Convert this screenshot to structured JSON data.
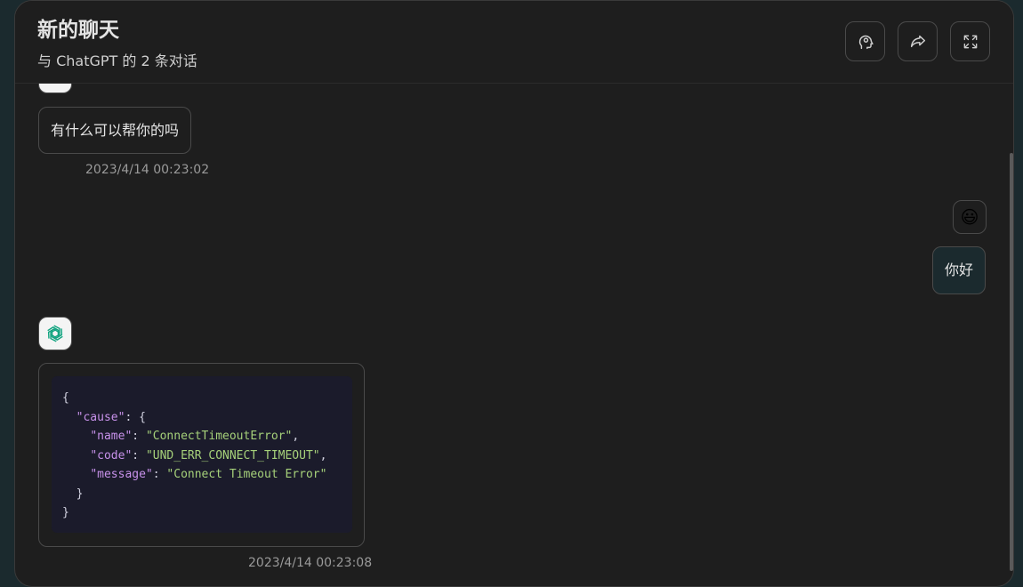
{
  "header": {
    "title": "新的聊天",
    "subtitle": "与 ChatGPT 的 2 条对话",
    "buttons": [
      {
        "name": "prompt-icon",
        "label": "prompt"
      },
      {
        "name": "share-icon",
        "label": "share"
      },
      {
        "name": "fullscreen-icon",
        "label": "fullscreen"
      }
    ]
  },
  "messages": [
    {
      "role": "assistant",
      "text": "有什么可以帮你的吗",
      "time": "2023/4/14 00:23:02"
    },
    {
      "role": "user",
      "avatar": "😃",
      "text": "你好"
    },
    {
      "role": "assistant",
      "code": {
        "l1": "{",
        "l2_key": "\"cause\"",
        "l2_rest": ": {",
        "l3_key": "\"name\"",
        "l3_val": "\"ConnectTimeoutError\"",
        "l4_key": "\"code\"",
        "l4_val": "\"UND_ERR_CONNECT_TIMEOUT\"",
        "l5_key": "\"message\"",
        "l5_val": "\"Connect Timeout Error\"",
        "l6": "}",
        "l7": "}"
      },
      "time": "2023/4/14 00:23:08"
    }
  ],
  "colors": {
    "background": "#1e1e1e",
    "border": "#4a4a4a",
    "code_bg": "#1b1b2b",
    "json_key": "#c791ea",
    "json_string": "#a6d17a",
    "openai_green": "#10a37f"
  }
}
